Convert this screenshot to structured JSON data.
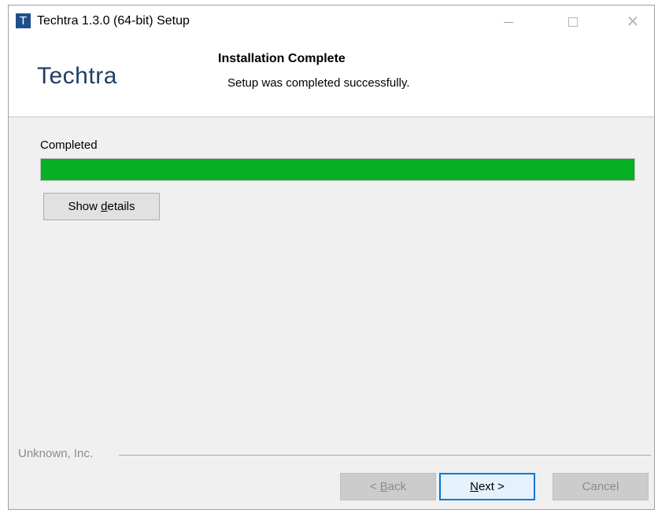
{
  "window": {
    "title": "Techtra 1.3.0 (64-bit) Setup",
    "icon_letter": "T",
    "controls": [
      "minimize-icon",
      "maximize-icon",
      "close-icon"
    ],
    "close_glyph": "✕"
  },
  "header": {
    "brand": "Techtra",
    "title": "Installation Complete",
    "subtitle": "Setup was completed successfully."
  },
  "body": {
    "status_label": "Completed",
    "progress_fraction": 1.0,
    "progress_color": "#06b025",
    "show_details_pre": "Show ",
    "show_details_accel": "d",
    "show_details_post": "etails"
  },
  "footer": {
    "brand": "Unknown, Inc.",
    "back_pre": "< ",
    "back_accel": "B",
    "back_post": "ack",
    "next_accel": "N",
    "next_post": "ext >",
    "cancel_label": "Cancel"
  }
}
